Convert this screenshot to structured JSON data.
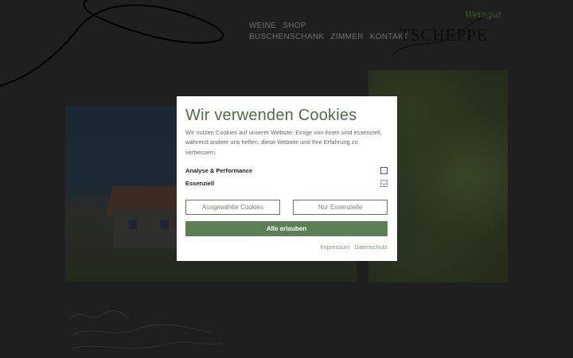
{
  "nav": {
    "row1": [
      "WEINE",
      "SHOP"
    ],
    "row2": [
      "BUSCHENSCHANK",
      "ZIMMER",
      "KONTAKT"
    ]
  },
  "logo": {
    "main": "TSCHEPPE",
    "script": "Weingut"
  },
  "cookie_modal": {
    "title": "Wir verwenden Cookies",
    "text": "Wir nutzen Cookies auf unserer Website. Einige von ihnen sind essenziell, während andere uns helfen, diese Website und Ihre Erfahrung zu verbessern.",
    "options": [
      {
        "label": "Analyse & Performance",
        "checked": false
      },
      {
        "label": "Essenziell",
        "checked": true
      }
    ],
    "buttons": {
      "selected": "Ausgewählte Cookies",
      "essential_only": "Nur Essenzielle",
      "allow_all": "Alle erlauben"
    },
    "links": {
      "impressum": "Impressum",
      "datenschutz": "Datenschutz"
    }
  },
  "colors": {
    "accent_green": "#5c7f55",
    "title_green": "#4f6f47",
    "overlay": "#1f1f1f"
  }
}
